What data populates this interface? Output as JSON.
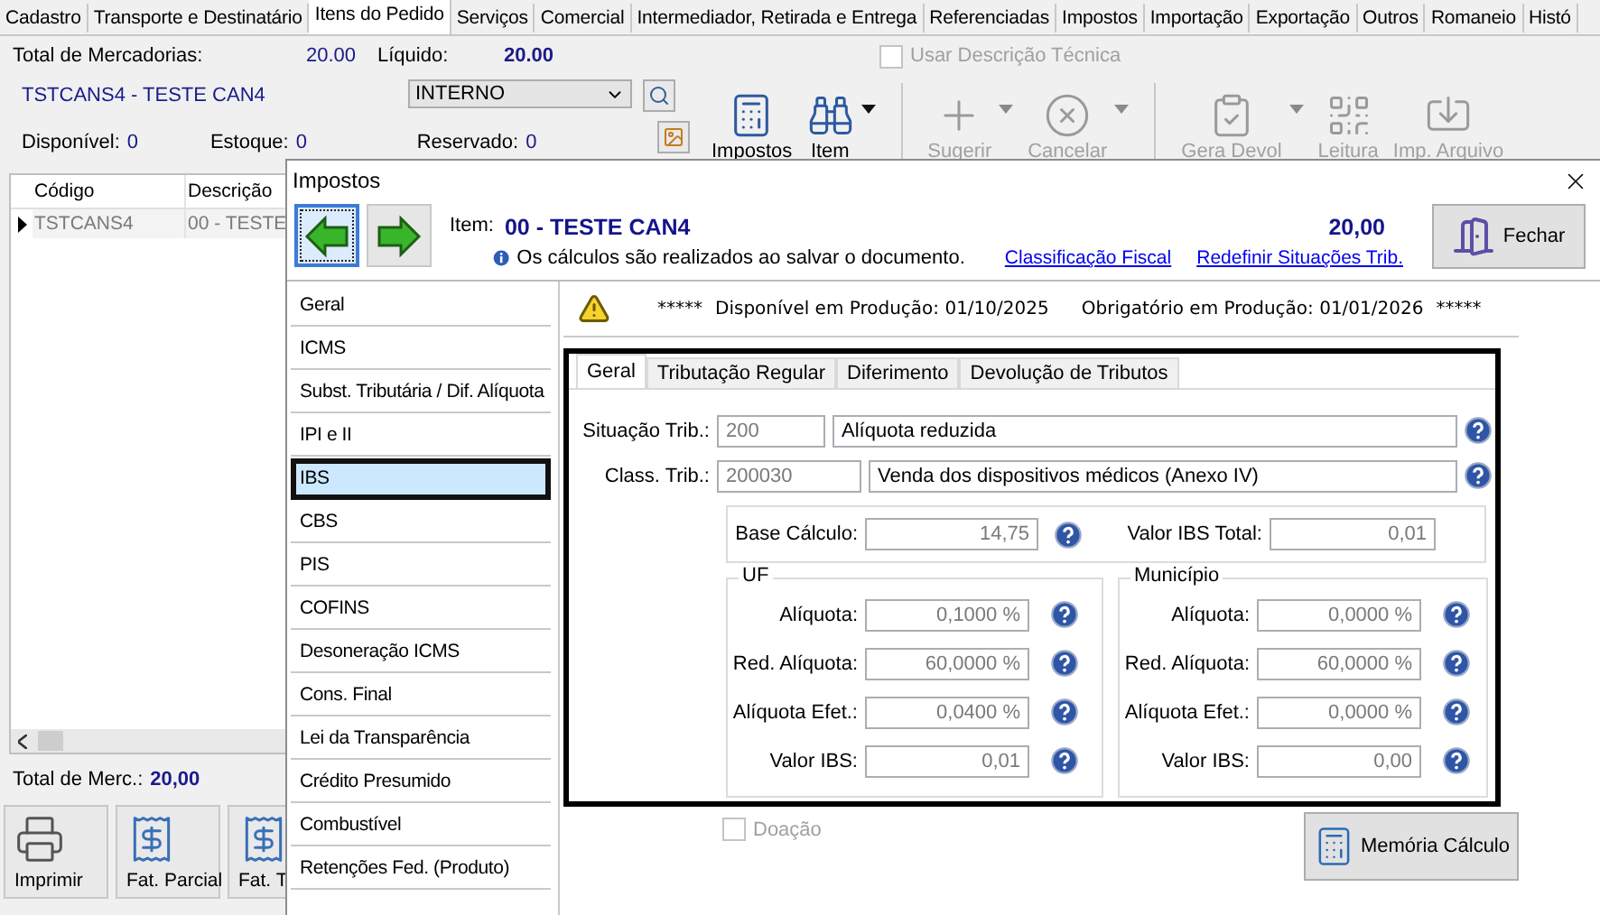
{
  "main_tabs": [
    {
      "label": "Cadastro",
      "selected": false
    },
    {
      "label": "Transporte e Destinatário",
      "selected": false
    },
    {
      "label": "Itens do Pedido",
      "selected": true
    },
    {
      "label": "Serviços",
      "selected": false
    },
    {
      "label": "Comercial",
      "selected": false
    },
    {
      "label": "Intermediador, Retirada e Entrega",
      "selected": false
    },
    {
      "label": "Referenciadas",
      "selected": false
    },
    {
      "label": "Impostos",
      "selected": false
    },
    {
      "label": "Importação",
      "selected": false
    },
    {
      "label": "Exportação",
      "selected": false
    },
    {
      "label": "Outros",
      "selected": false
    },
    {
      "label": "Romaneio",
      "selected": false
    },
    {
      "label": "Histó",
      "selected": false
    }
  ],
  "totals": {
    "merch_label": "Total de Mercadorias:",
    "merch_value": "20.00",
    "net_label": "Líquido:",
    "net_value": "20.00"
  },
  "tech_description": {
    "label": "Usar Descrição Técnica",
    "checked": false,
    "disabled": true
  },
  "product": {
    "name": "TSTCANS4 - TESTE CAN4",
    "operation": "INTERNO",
    "stock": [
      {
        "label": "Disponível:",
        "value": "0"
      },
      {
        "label": "Estoque:",
        "value": "0"
      },
      {
        "label": "Reservado:",
        "value": "0"
      }
    ]
  },
  "toolbar": {
    "groups": [
      {
        "buttons": [
          {
            "label": "Impostos",
            "disabled": false,
            "dropdown": false
          },
          {
            "label": "Item",
            "disabled": false,
            "dropdown": true
          }
        ]
      },
      {
        "buttons": [
          {
            "label": "Sugerir",
            "disabled": true,
            "dropdown": true
          },
          {
            "label": "Cancelar",
            "disabled": true,
            "dropdown": true
          }
        ]
      },
      {
        "buttons": [
          {
            "label": "Gera Devol",
            "disabled": true,
            "dropdown": true
          },
          {
            "label": "Leitura",
            "disabled": true,
            "dropdown": false
          },
          {
            "label": "Imp. Arquivo",
            "disabled": true,
            "dropdown": false
          }
        ]
      }
    ]
  },
  "grid": {
    "columns": [
      "Código",
      "Descrição"
    ],
    "rows": [
      {
        "cells": [
          "TSTCANS4",
          "00 - TESTE"
        ],
        "selected": true
      }
    ]
  },
  "footer_total": {
    "label": "Total de Merc.:",
    "value": "20,00"
  },
  "bottom_buttons": [
    "Imprimir",
    "Fat. Parcial",
    "Fat. T"
  ],
  "dialog": {
    "title": "Impostos",
    "nav": [
      {
        "kind": "back",
        "selected": true
      },
      {
        "kind": "forward",
        "selected": false
      }
    ],
    "item_label": "Item:",
    "item_value": "00 - TESTE CAN4",
    "note": "Os cálculos são realizados ao salvar o documento.",
    "amount": "20,00",
    "links": [
      "Classificação Fiscal",
      "Redefinir Situações Trib."
    ],
    "close_button": "Fechar",
    "sections": [
      {
        "label": "Geral",
        "selected": false
      },
      {
        "label": "ICMS",
        "selected": false
      },
      {
        "label": "Subst. Tributária / Dif. Alíquota",
        "selected": false
      },
      {
        "label": "IPI e II",
        "selected": false
      },
      {
        "label": "IBS",
        "selected": true
      },
      {
        "label": "CBS",
        "selected": false
      },
      {
        "label": "PIS",
        "selected": false
      },
      {
        "label": "COFINS",
        "selected": false
      },
      {
        "label": "Desoneração ICMS",
        "selected": false
      },
      {
        "label": "Cons. Final",
        "selected": false
      },
      {
        "label": "Lei da Transparência",
        "selected": false
      },
      {
        "label": "Crédito Presumido",
        "selected": false
      },
      {
        "label": "Combustível",
        "selected": false
      },
      {
        "label": "Retenções Fed. (Produto)",
        "selected": false
      }
    ],
    "notice": {
      "prefix": "*****",
      "available": "Disponível em Produção: 01/10/2025",
      "mandatory": "Obrigatório em Produção: 01/01/2026",
      "suffix": "*****"
    },
    "tabs": [
      {
        "label": "Geral",
        "selected": true
      },
      {
        "label": "Tributação Regular",
        "selected": false
      },
      {
        "label": "Diferimento",
        "selected": false
      },
      {
        "label": "Devolução de Tributos",
        "selected": false
      }
    ],
    "situation": {
      "label": "Situação Trib.:",
      "code": "200",
      "description": "Alíquota reduzida"
    },
    "classification": {
      "label": "Class. Trib.:",
      "code": "200030",
      "description": "Venda dos dispositivos médicos  (Anexo IV)"
    },
    "base": {
      "label": "Base Cálculo:",
      "value": "14,75"
    },
    "total": {
      "label": "Valor IBS Total:",
      "value": "0,01"
    },
    "groups": [
      {
        "title": "UF",
        "fields": [
          {
            "label": "Alíquota:",
            "value": "0,1000 %"
          },
          {
            "label": "Red. Alíquota:",
            "value": "60,0000 %"
          },
          {
            "label": "Alíquota Efet.:",
            "value": "0,0400 %"
          },
          {
            "label": "Valor IBS:",
            "value": "0,01"
          }
        ]
      },
      {
        "title": "Município",
        "fields": [
          {
            "label": "Alíquota:",
            "value": "0,0000 %"
          },
          {
            "label": "Red. Alíquota:",
            "value": "60,0000 %"
          },
          {
            "label": "Alíquota Efet.:",
            "value": "0,0000 %"
          },
          {
            "label": "Valor IBS:",
            "value": "0,00"
          }
        ]
      }
    ],
    "donation": {
      "label": "Doação",
      "checked": false,
      "disabled": true
    },
    "memory_button": "Memória Cálculo"
  }
}
